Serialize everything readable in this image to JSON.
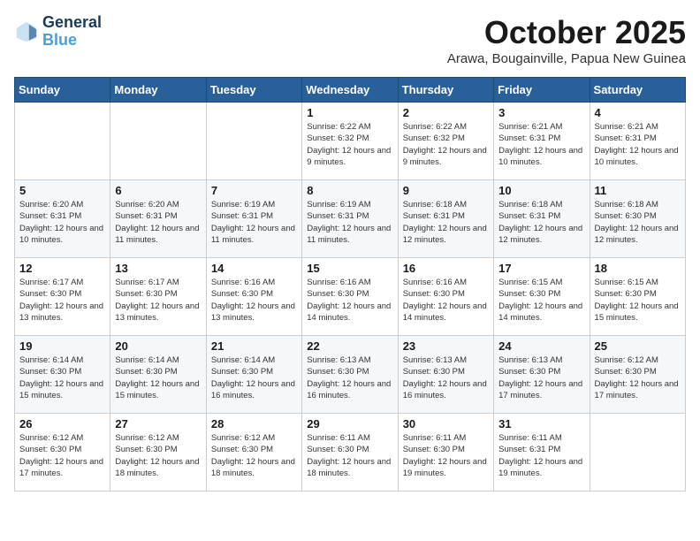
{
  "logo": {
    "line1": "General",
    "line2": "Blue"
  },
  "header": {
    "month": "October 2025",
    "location": "Arawa, Bougainville, Papua New Guinea"
  },
  "weekdays": [
    "Sunday",
    "Monday",
    "Tuesday",
    "Wednesday",
    "Thursday",
    "Friday",
    "Saturday"
  ],
  "weeks": [
    [
      {
        "day": "",
        "sunrise": "",
        "sunset": "",
        "daylight": ""
      },
      {
        "day": "",
        "sunrise": "",
        "sunset": "",
        "daylight": ""
      },
      {
        "day": "",
        "sunrise": "",
        "sunset": "",
        "daylight": ""
      },
      {
        "day": "1",
        "sunrise": "6:22 AM",
        "sunset": "6:32 PM",
        "daylight": "12 hours and 9 minutes."
      },
      {
        "day": "2",
        "sunrise": "6:22 AM",
        "sunset": "6:32 PM",
        "daylight": "12 hours and 9 minutes."
      },
      {
        "day": "3",
        "sunrise": "6:21 AM",
        "sunset": "6:31 PM",
        "daylight": "12 hours and 10 minutes."
      },
      {
        "day": "4",
        "sunrise": "6:21 AM",
        "sunset": "6:31 PM",
        "daylight": "12 hours and 10 minutes."
      }
    ],
    [
      {
        "day": "5",
        "sunrise": "6:20 AM",
        "sunset": "6:31 PM",
        "daylight": "12 hours and 10 minutes."
      },
      {
        "day": "6",
        "sunrise": "6:20 AM",
        "sunset": "6:31 PM",
        "daylight": "12 hours and 11 minutes."
      },
      {
        "day": "7",
        "sunrise": "6:19 AM",
        "sunset": "6:31 PM",
        "daylight": "12 hours and 11 minutes."
      },
      {
        "day": "8",
        "sunrise": "6:19 AM",
        "sunset": "6:31 PM",
        "daylight": "12 hours and 11 minutes."
      },
      {
        "day": "9",
        "sunrise": "6:18 AM",
        "sunset": "6:31 PM",
        "daylight": "12 hours and 12 minutes."
      },
      {
        "day": "10",
        "sunrise": "6:18 AM",
        "sunset": "6:31 PM",
        "daylight": "12 hours and 12 minutes."
      },
      {
        "day": "11",
        "sunrise": "6:18 AM",
        "sunset": "6:30 PM",
        "daylight": "12 hours and 12 minutes."
      }
    ],
    [
      {
        "day": "12",
        "sunrise": "6:17 AM",
        "sunset": "6:30 PM",
        "daylight": "12 hours and 13 minutes."
      },
      {
        "day": "13",
        "sunrise": "6:17 AM",
        "sunset": "6:30 PM",
        "daylight": "12 hours and 13 minutes."
      },
      {
        "day": "14",
        "sunrise": "6:16 AM",
        "sunset": "6:30 PM",
        "daylight": "12 hours and 13 minutes."
      },
      {
        "day": "15",
        "sunrise": "6:16 AM",
        "sunset": "6:30 PM",
        "daylight": "12 hours and 14 minutes."
      },
      {
        "day": "16",
        "sunrise": "6:16 AM",
        "sunset": "6:30 PM",
        "daylight": "12 hours and 14 minutes."
      },
      {
        "day": "17",
        "sunrise": "6:15 AM",
        "sunset": "6:30 PM",
        "daylight": "12 hours and 14 minutes."
      },
      {
        "day": "18",
        "sunrise": "6:15 AM",
        "sunset": "6:30 PM",
        "daylight": "12 hours and 15 minutes."
      }
    ],
    [
      {
        "day": "19",
        "sunrise": "6:14 AM",
        "sunset": "6:30 PM",
        "daylight": "12 hours and 15 minutes."
      },
      {
        "day": "20",
        "sunrise": "6:14 AM",
        "sunset": "6:30 PM",
        "daylight": "12 hours and 15 minutes."
      },
      {
        "day": "21",
        "sunrise": "6:14 AM",
        "sunset": "6:30 PM",
        "daylight": "12 hours and 16 minutes."
      },
      {
        "day": "22",
        "sunrise": "6:13 AM",
        "sunset": "6:30 PM",
        "daylight": "12 hours and 16 minutes."
      },
      {
        "day": "23",
        "sunrise": "6:13 AM",
        "sunset": "6:30 PM",
        "daylight": "12 hours and 16 minutes."
      },
      {
        "day": "24",
        "sunrise": "6:13 AM",
        "sunset": "6:30 PM",
        "daylight": "12 hours and 17 minutes."
      },
      {
        "day": "25",
        "sunrise": "6:12 AM",
        "sunset": "6:30 PM",
        "daylight": "12 hours and 17 minutes."
      }
    ],
    [
      {
        "day": "26",
        "sunrise": "6:12 AM",
        "sunset": "6:30 PM",
        "daylight": "12 hours and 17 minutes."
      },
      {
        "day": "27",
        "sunrise": "6:12 AM",
        "sunset": "6:30 PM",
        "daylight": "12 hours and 18 minutes."
      },
      {
        "day": "28",
        "sunrise": "6:12 AM",
        "sunset": "6:30 PM",
        "daylight": "12 hours and 18 minutes."
      },
      {
        "day": "29",
        "sunrise": "6:11 AM",
        "sunset": "6:30 PM",
        "daylight": "12 hours and 18 minutes."
      },
      {
        "day": "30",
        "sunrise": "6:11 AM",
        "sunset": "6:30 PM",
        "daylight": "12 hours and 19 minutes."
      },
      {
        "day": "31",
        "sunrise": "6:11 AM",
        "sunset": "6:31 PM",
        "daylight": "12 hours and 19 minutes."
      },
      {
        "day": "",
        "sunrise": "",
        "sunset": "",
        "daylight": ""
      }
    ]
  ]
}
